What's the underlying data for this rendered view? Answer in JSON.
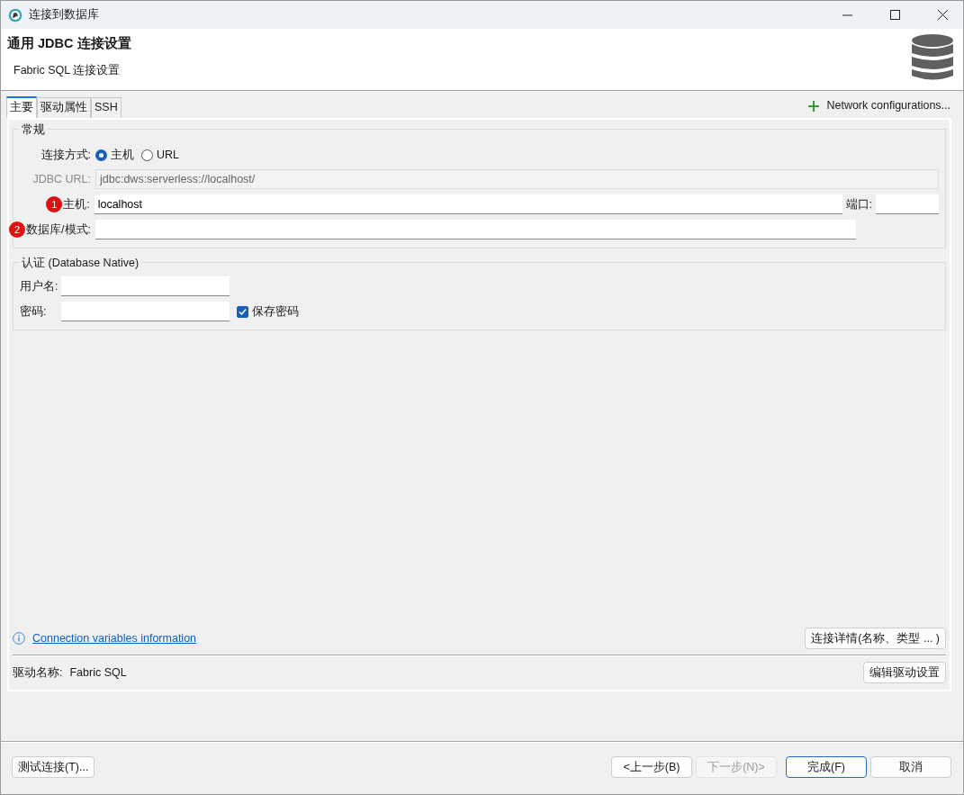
{
  "window": {
    "title": "连接到数据库"
  },
  "header": {
    "title": "通用 JDBC 连接设置",
    "subtitle": "Fabric SQL 连接设置"
  },
  "tabs": [
    {
      "label": "主要",
      "selected": true
    },
    {
      "label": "驱动属性",
      "selected": false
    },
    {
      "label": "SSH",
      "selected": false
    }
  ],
  "network_link": "Network configurations...",
  "general": {
    "legend": "常规",
    "connection_type": {
      "label": "连接方式:",
      "options": [
        {
          "label": "主机",
          "selected": true
        },
        {
          "label": "URL",
          "selected": false
        }
      ]
    },
    "jdbc_url": {
      "label": "JDBC URL:",
      "value": "jdbc:dws:serverless://localhost/",
      "disabled": true
    },
    "host": {
      "label": "主机:",
      "value": "localhost",
      "marker": "1"
    },
    "port": {
      "label": "端口:"
    },
    "database": {
      "label": "数据库/模式:",
      "marker": "2"
    }
  },
  "auth": {
    "legend": "认证 (Database Native)",
    "username": {
      "label": "用户名:"
    },
    "password": {
      "label": "密码:"
    },
    "save_password": {
      "label": "保存密码",
      "checked": true
    }
  },
  "info_link": "Connection variables information",
  "details_button": "连接详情(名称、类型 ... )",
  "driver": {
    "label": "驱动名称:",
    "value": "Fabric SQL"
  },
  "edit_driver_button": "编辑驱动设置",
  "footer": {
    "test_button": "测试连接(T)...",
    "buttons": [
      {
        "label": "<上一步(B)",
        "disabled": false,
        "default": false
      },
      {
        "label": "下一步(N)>",
        "disabled": true,
        "default": false
      },
      {
        "label": "完成(F)",
        "disabled": false,
        "default": true
      },
      {
        "label": "取消",
        "disabled": false,
        "default": false
      }
    ]
  }
}
